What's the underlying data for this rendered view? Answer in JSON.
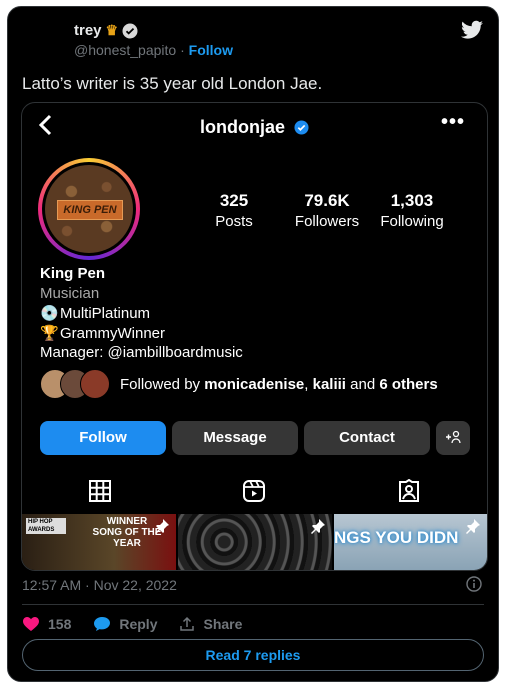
{
  "tweet": {
    "author_name": "trey",
    "author_handle": "@honest_papito",
    "separator": "·",
    "follow_label": "Follow",
    "text": "Latto’s writer is 35 year old London Jae.",
    "timestamp": "12:57 AM · Nov 22, 2022",
    "likes": "158",
    "reply_label": "Reply",
    "share_label": "Share",
    "read_replies_label": "Read 7 replies"
  },
  "instagram": {
    "username": "londonjae",
    "more_label": "•••",
    "profile_badge_text": "KING PEN",
    "stats": [
      {
        "value": "325",
        "label": "Posts"
      },
      {
        "value": "79.6K",
        "label": "Followers"
      },
      {
        "value": "1,303",
        "label": "Following"
      }
    ],
    "display_name": "King Pen",
    "category": "Musician",
    "bio_line1": "MultiPlatinum",
    "bio_line2": "GrammyWinner",
    "bio_line3": "Manager: @iambillboardmusic",
    "followed_prefix": "Followed by ",
    "followed_user1": "monicadenise",
    "followed_sep": ", ",
    "followed_user2": "kaliii",
    "followed_and": " and ",
    "followed_others": "6 others",
    "buttons": {
      "follow": "Follow",
      "message": "Message",
      "contact": "Contact",
      "add_user": "+ዳ"
    },
    "thumbs": {
      "t1_badge": "HIP HOP AWARDS",
      "t1_text_line1": "WINNER",
      "t1_text_line2": "SONG OF THE YEAR",
      "t3_text": "NGS YOU DIDN"
    }
  },
  "colors": {
    "accent": "#1d9bf0",
    "ig_follow": "#1d8cf0",
    "like": "#f91880"
  },
  "icons": [
    "twitter-icon",
    "verified-icon",
    "back-icon",
    "more-icon",
    "grid-icon",
    "reels-icon",
    "tagged-icon",
    "pin-icon",
    "info-icon",
    "heart-icon",
    "reply-icon",
    "share-icon"
  ]
}
